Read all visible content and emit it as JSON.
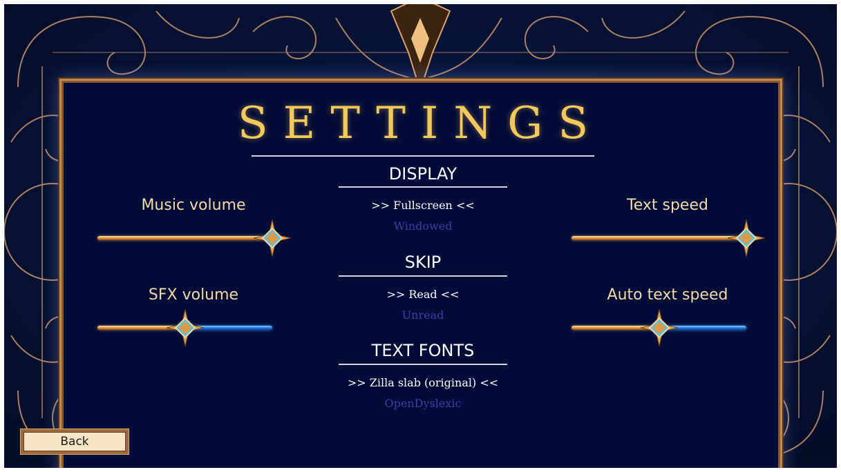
{
  "screen": {
    "title": "SETTINGS",
    "colors": {
      "gold": "#f2c95a",
      "panel": "#030c38",
      "selected": "#ffffff",
      "unselected": "#3340a8",
      "track_fill": "#d68a35",
      "track_rest": "#1f6fe0"
    }
  },
  "sliders": {
    "music": {
      "label": "Music volume",
      "value_fraction": 1.0
    },
    "sfx": {
      "label": "SFX volume",
      "value_fraction": 0.5
    },
    "text_speed": {
      "label": "Text speed",
      "value_fraction": 1.0
    },
    "auto_text_speed": {
      "label": "Auto text speed",
      "value_fraction": 0.5
    }
  },
  "display": {
    "heading": "DISPLAY",
    "selected": ">> Fullscreen <<",
    "other": "Windowed"
  },
  "skip": {
    "heading": "SKIP",
    "selected": ">> Read <<",
    "other": "Unread"
  },
  "fonts": {
    "heading": "TEXT FONTS",
    "selected": ">> Zilla slab (original) <<",
    "other": "OpenDyslexic"
  },
  "buttons": {
    "back": "Back"
  },
  "icons": {
    "slider_knob": "compass-star-icon",
    "frame": "ornamental-swirl-frame"
  }
}
